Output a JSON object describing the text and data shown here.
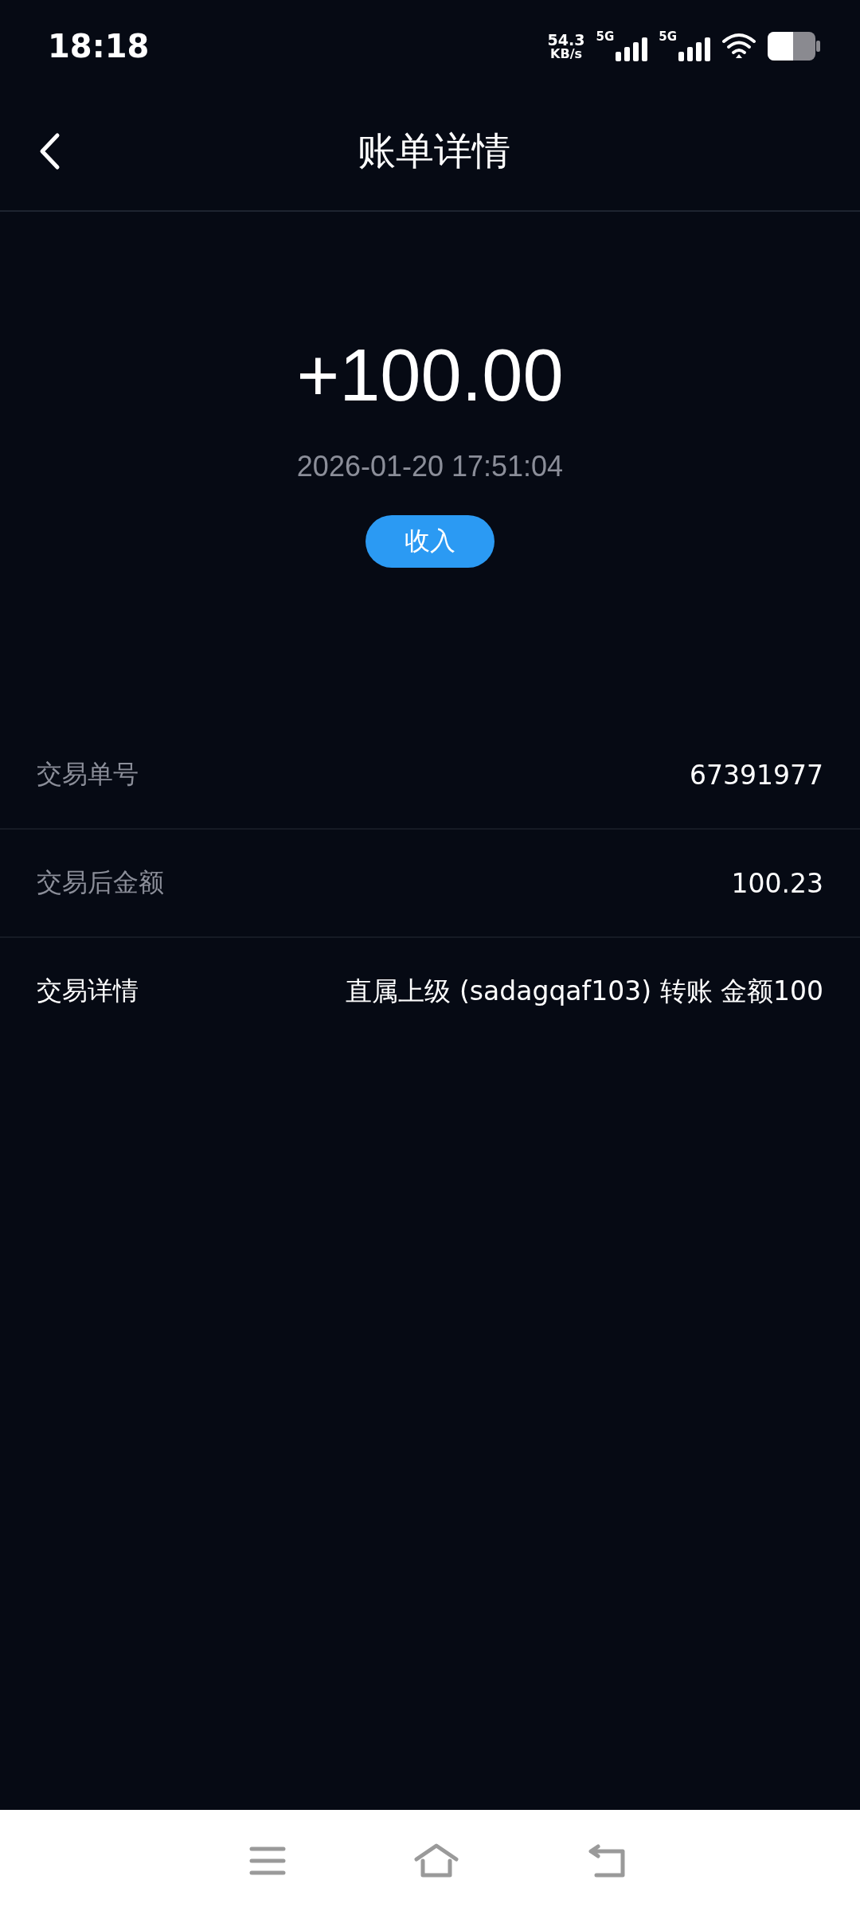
{
  "status_bar": {
    "time": "18:18",
    "net_speed": "54.3",
    "net_unit": "KB/s",
    "sim_1": "5G",
    "sim_2": "5G"
  },
  "header": {
    "title": "账单详情"
  },
  "summary": {
    "amount": "+100.00",
    "datetime": "2026-01-20 17:51:04",
    "type_badge": "收入"
  },
  "details": [
    {
      "label": "交易单号",
      "value": "67391977",
      "highlight": false
    },
    {
      "label": "交易后金额",
      "value": "100.23",
      "highlight": false
    },
    {
      "label": "交易详情",
      "value": "直属上级 (sadagqaf103) 转账 金额100",
      "highlight": true
    }
  ]
}
